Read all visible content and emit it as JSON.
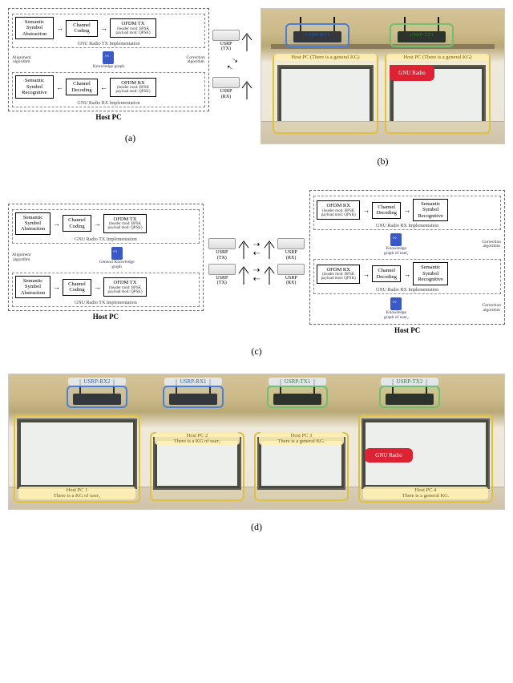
{
  "fig_a": {
    "hostpc": "Host PC",
    "tx_impl": "GNU Radio TX Implementation",
    "rx_impl": "GNU Radio RX Implementation",
    "sem_abs": "Semantic\nSymbol\nAbstraction",
    "sem_rec": "Semantic\nSymbol\nRecognitive",
    "ch_cod": "Channel\nCoding",
    "ch_dec": "Channel\nDecoding",
    "ofdm_tx": "OFDM TX",
    "ofdm_rx": "OFDM RX",
    "ofdm_sub": "(header mod: BPSK\npayload mod: QPSK)",
    "kg": "Knowledge graph",
    "align": "Alignment\nalgorithm",
    "correct": "Correction\nalgorithm",
    "usrp_tx": "USRP\n(TX)",
    "usrp_rx": "USRP\n(RX)",
    "caption": "(a)"
  },
  "fig_b": {
    "usrp_rx1": "USRP-RX1",
    "usrp_tx1": "USRP-TX1",
    "host_l": "Host PC\n(There is a general KG)",
    "host_r": "Host PC\n(There is a general KG)",
    "gnu": "GNU Radio",
    "caption": "(b)"
  },
  "fig_c": {
    "hostpc": "Host PC",
    "tx_impl": "GNU Radio TX Implementation",
    "rx_impl": "GNU Radio RX Implementation",
    "sem_abs": "Semantic\nSymbol\nAbstraction",
    "sem_rec": "Semantic\nSymbol\nRecognitive",
    "ch_cod": "Channel\nCoding",
    "ch_dec": "Channel\nDecoding",
    "ofdm_tx": "OFDM TX",
    "ofdm_rx": "OFDM RX",
    "ofdm_sub": "(header mod: BPSK\npayload mod: QPSK)",
    "gkg": "General Knowledge\ngraph",
    "kg_u1": "Knowledge\ngraph of user₁",
    "kg_u2": "Knowledge\ngraph of user₂",
    "align": "Alignment\nalgorithm",
    "correct": "Correction\nalgorithm",
    "usrp_tx": "USRP\n(TX)",
    "usrp_rx": "USRP\n(RX)",
    "caption": "(c)"
  },
  "fig_d": {
    "usrp_rx2": "USRP-RX2",
    "usrp_rx1": "USRP-RX1",
    "usrp_tx1": "USRP-TX1",
    "usrp_tx2": "USRP-TX2",
    "pc1": "Host PC 1\nThere is a KG of user₂",
    "pc2": "Host PC 2\nThere is a KG of user₁",
    "pc3": "Host PC 3\nThere is a general KG.",
    "pc4": "Host PC 4\nThere is a general KG.",
    "gnu": "GNU Radio",
    "caption": "(d)"
  }
}
